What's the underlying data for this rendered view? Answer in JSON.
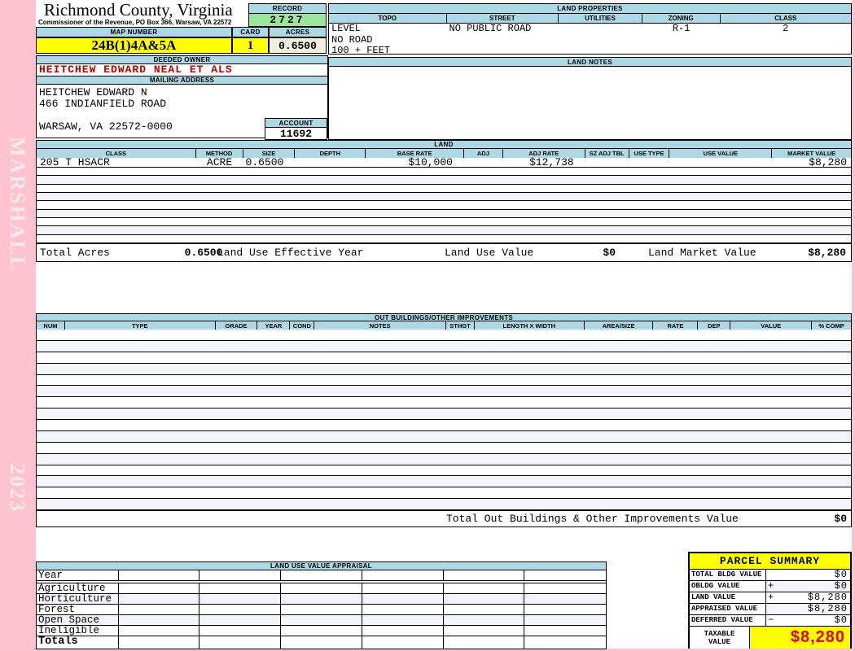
{
  "sidebar": {
    "label": "MARSHALL",
    "year": "2023"
  },
  "header": {
    "county": "Richmond County, Virginia",
    "subtitle": "Commissioner of the Revenue, PO Box 366, Warsaw, VA 22572",
    "record_label": "RECORD",
    "record_value": "2727",
    "map_number_label": "MAP NUMBER",
    "map_number": "24B(1)4A&5A",
    "card_label": "CARD",
    "card": "1",
    "acres_label": "ACRES",
    "acres": "0.6500"
  },
  "land_properties": {
    "title": "LAND PROPERTIES",
    "columns": [
      "TOPO",
      "STREET",
      "UTILITIES",
      "ZONING",
      "CLASS"
    ],
    "values": [
      "LEVEL",
      "NO PUBLIC ROAD",
      "",
      "R-1",
      "2"
    ],
    "extra_lines": [
      "NO ROAD",
      "100 + FEET"
    ]
  },
  "owner": {
    "deeded_owner_label": "DEEDED OWNER",
    "deeded_owner": "HEITCHEW EDWARD NEAL ET ALS",
    "mailing_address_label": "MAILING ADDRESS",
    "address_lines": [
      "HEITCHEW EDWARD N",
      "466 INDIANFIELD ROAD",
      "",
      "WARSAW, VA 22572-0000"
    ],
    "account_label": "ACCOUNT",
    "account": "11692"
  },
  "land_notes": {
    "title": "LAND NOTES"
  },
  "land_table": {
    "title": "LAND",
    "columns": [
      "CLASS",
      "METHOD",
      "SIZE",
      "DEPTH",
      "BASE RATE",
      "ADJ",
      "ADJ RATE",
      "SZ ADJ TBL",
      "USE TYPE",
      "USE VALUE",
      "MARKET VALUE"
    ],
    "rows": [
      [
        "205 T HSACR",
        "ACRE",
        "0.6500",
        "",
        "$10,000",
        "",
        "$12,738",
        "",
        "",
        "",
        "$8,280"
      ]
    ],
    "empty_row_count": 9,
    "totals": {
      "total_acres_label": "Total Acres",
      "total_acres": "0.6500",
      "effective_year_label": "Land Use Effective Year",
      "use_value_label": "Land Use Value",
      "use_value": "$0",
      "market_value_label": "Land Market Value",
      "market_value": "$8,280"
    }
  },
  "out_buildings": {
    "title": "OUT BUILDINGS/OTHER IMPROVEMENTS",
    "columns": [
      "NUM",
      "TYPE",
      "GRADE",
      "YEAR",
      "COND",
      "NOTES",
      "STHGT",
      "LENGTH X WIDTH",
      "AREA/SIZE",
      "RATE",
      "DEP",
      "VALUE",
      "% COMP"
    ],
    "empty_row_count": 16,
    "total_label": "Total Out Buildings & Other Improvements Value",
    "total_value": "$0"
  },
  "land_use_appraisal": {
    "title": "LAND USE VALUE APPRAISAL",
    "row_labels": [
      "Year",
      "Agriculture",
      "Horticulture",
      "Forest",
      "Open Space",
      "Ineligible",
      "Totals"
    ],
    "column_count": 6
  },
  "parcel_summary": {
    "title": "PARCEL SUMMARY",
    "rows": [
      {
        "label": "TOTAL BLDG VALUE",
        "op": "",
        "value": "$0"
      },
      {
        "label": "OBLDG VALUE",
        "op": "+",
        "value": "$0"
      },
      {
        "label": "LAND VALUE",
        "op": "+",
        "value": "$8,280"
      },
      {
        "label": "APPRAISED VALUE",
        "op": "",
        "value": "$8,280"
      },
      {
        "label": "DEFERRED VALUE",
        "op": "−",
        "value": "$0"
      }
    ],
    "taxable_label_line1": "TAXABLE",
    "taxable_label_line2": "VALUE",
    "taxable_value": "$8,280"
  },
  "colors": {
    "header_blue": "#ADD8E6",
    "record_green": "#9CE69C",
    "highlight_yellow": "#FFFF00",
    "acres_cream": "#F0EFDC",
    "sidebar_pink": "#FFC3CF",
    "owner_red": "#C00000",
    "taxable_red": "#E60000",
    "stripe": "#F4F4FB"
  }
}
